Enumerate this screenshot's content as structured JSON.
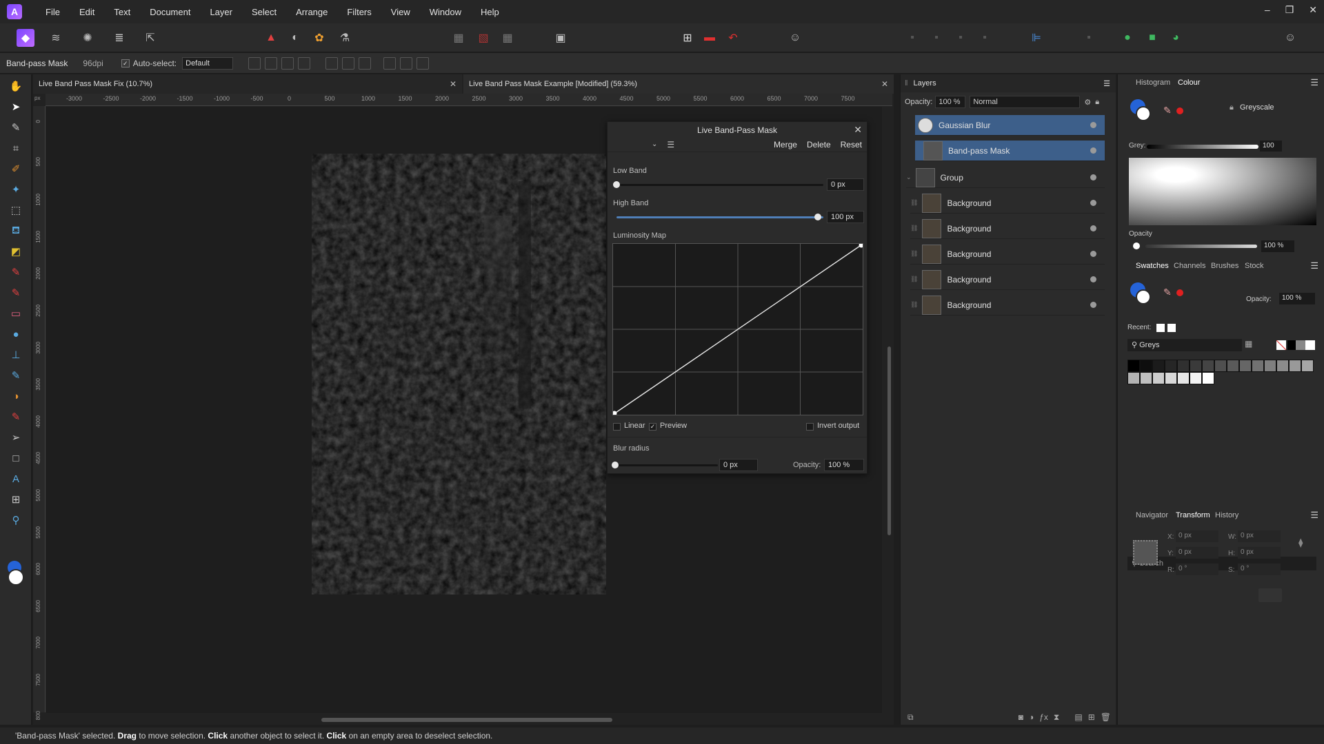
{
  "app": {
    "name": "Affinity Photo"
  },
  "menu": [
    "File",
    "Edit",
    "Text",
    "Document",
    "Layer",
    "Select",
    "Arrange",
    "Filters",
    "View",
    "Window",
    "Help"
  ],
  "context_bar": {
    "selection": "Band-pass Mask",
    "dpi": "96dpi",
    "auto_select_label": "Auto-select:",
    "auto_select_value": "Default"
  },
  "tabs": [
    {
      "label": "Live Band Pass Mask Fix (10.7%)"
    },
    {
      "label": "Live Band Pass Mask Example [Modified] (59.3%)"
    }
  ],
  "ruler_h": [
    "-3000",
    "-2500",
    "-2000",
    "-1500",
    "-1000",
    "-500",
    "0",
    "500",
    "1000",
    "1500",
    "2000",
    "2500",
    "3000",
    "3500",
    "4000",
    "4500",
    "5000",
    "5500",
    "6000",
    "6500",
    "7000",
    "7500"
  ],
  "ruler_v": [
    "0",
    "500",
    "1000",
    "1500",
    "2000",
    "2500",
    "3000",
    "3500",
    "4000",
    "4500",
    "5000",
    "5500",
    "6000",
    "6500",
    "7000",
    "7500",
    "800"
  ],
  "ruler_unit": "px",
  "bandpass": {
    "title": "Live Band-Pass Mask",
    "merge": "Merge",
    "delete": "Delete",
    "reset": "Reset",
    "low_band_label": "Low Band",
    "low_band_value": "0 px",
    "low_band_fraction": 0,
    "high_band_label": "High Band",
    "high_band_value": "100 px",
    "high_band_fraction": 1,
    "lum_map_label": "Luminosity Map",
    "linear_label": "Linear",
    "preview_label": "Preview",
    "invert_label": "Invert output",
    "blur_label": "Blur radius",
    "blur_value": "0 px",
    "opacity_label": "Opacity:",
    "opacity_value": "100 %"
  },
  "layers_panel": {
    "title": "Layers",
    "opacity_label": "Opacity:",
    "opacity_value": "100 %",
    "blend_mode": "Normal",
    "rows": [
      {
        "name": "Gaussian Blur",
        "selected": true
      },
      {
        "name": "Band-pass Mask",
        "selected": true
      },
      {
        "name": "Group",
        "selected": false
      },
      {
        "name": "Background",
        "selected": false
      },
      {
        "name": "Background",
        "selected": false
      },
      {
        "name": "Background",
        "selected": false
      },
      {
        "name": "Background",
        "selected": false
      },
      {
        "name": "Background",
        "selected": false
      }
    ]
  },
  "colour_panel": {
    "tab_histogram": "Histogram",
    "tab_colour": "Colour",
    "mode": "Greyscale",
    "grey_label": "Grey:",
    "grey_value": "100",
    "opacity_label": "Opacity",
    "opacity_value": "100 %"
  },
  "swatches_panel": {
    "tabs": [
      "Swatches",
      "Channels",
      "Brushes",
      "Stock"
    ],
    "opacity_label": "Opacity:",
    "opacity_value": "100 %",
    "recent_label": "Recent:",
    "palette": "Greys",
    "grey_swatches": [
      "#000000",
      "#0e0e0e",
      "#1b1b1b",
      "#262626",
      "#303030",
      "#3a3a3a",
      "#444444",
      "#4f4f4f",
      "#5a5a5a",
      "#666666",
      "#727272",
      "#7f7f7f",
      "#8c8c8c",
      "#999999",
      "#a6a6a6",
      "#b3b3b3",
      "#bfbfbf",
      "#cccccc",
      "#d9d9d9",
      "#e6e6e6",
      "#f2f2f2",
      "#ffffff"
    ]
  },
  "search_placeholder": "Search",
  "transform_panel": {
    "tabs": [
      "Navigator",
      "Transform",
      "History"
    ],
    "x_label": "X:",
    "x_value": "0 px",
    "y_label": "Y:",
    "y_value": "0 px",
    "w_label": "W:",
    "w_value": "0 px",
    "h_label": "H:",
    "h_value": "0 px",
    "r_label": "R:",
    "r_value": "0 °",
    "s_label": "S:",
    "s_value": "0 °"
  },
  "status": {
    "part1": "'Band-pass Mask' selected.",
    "drag": "Drag",
    "part2": "to move selection.",
    "click1": "Click",
    "part3": "another object to select it.",
    "click2": "Click",
    "part4": "on an empty area to deselect selection."
  },
  "colors": {
    "accent": "#4a6fa5",
    "selection": "#3d5f8a",
    "red": "#e02020",
    "blue": "#2563d8"
  }
}
